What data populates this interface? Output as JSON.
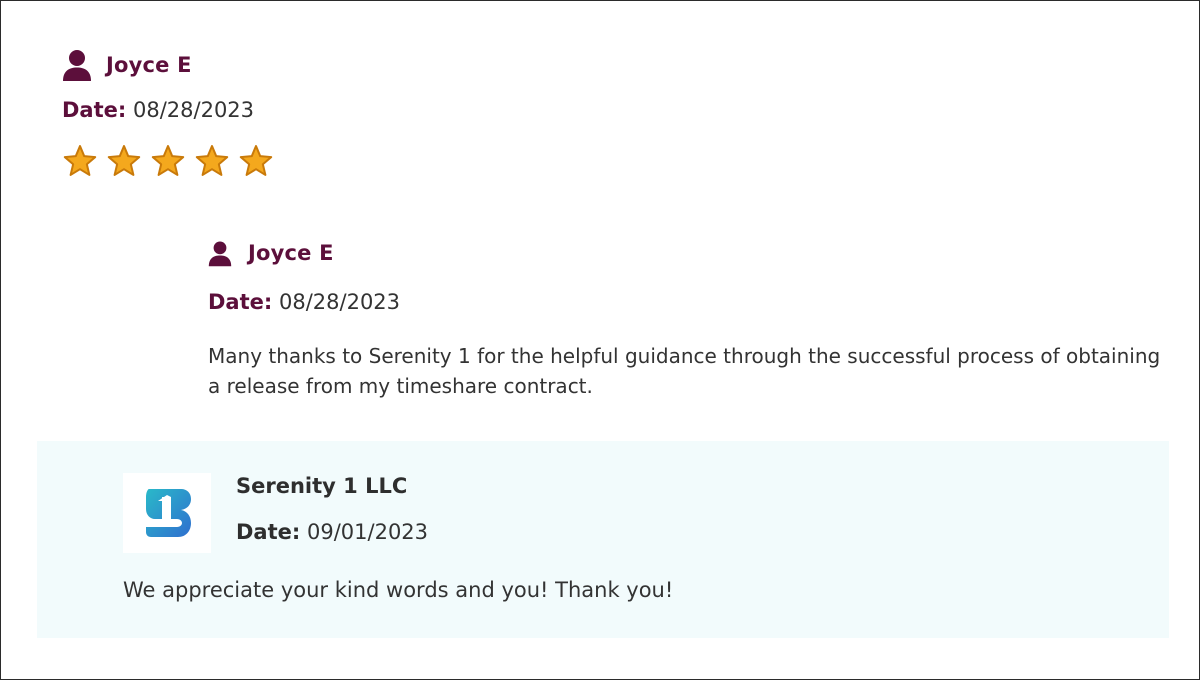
{
  "review": {
    "author": "Joyce E",
    "date_label": "Date:",
    "date": "08/28/2023",
    "rating": 5,
    "rating_max": 5,
    "text": "Many thanks to Serenity 1 for the helpful guidance through the successful process of obtaining a release from my timeshare contract."
  },
  "reply": {
    "company": "Serenity 1 LLC",
    "date_label": "Date:",
    "date": "09/01/2023",
    "text": "We appreciate your kind words and you! Thank you!"
  },
  "colors": {
    "name_accent": "#5c0f3b",
    "star_fill": "#f4a81d",
    "star_stroke": "#c97a0a",
    "reply_background": "#f2fbfc",
    "logo_gradient_start": "#2ab9c9",
    "logo_gradient_end": "#2f6fcf"
  },
  "icons": {
    "author": "user-icon",
    "rating": "star-icon",
    "company_logo": "serenity-logo"
  }
}
